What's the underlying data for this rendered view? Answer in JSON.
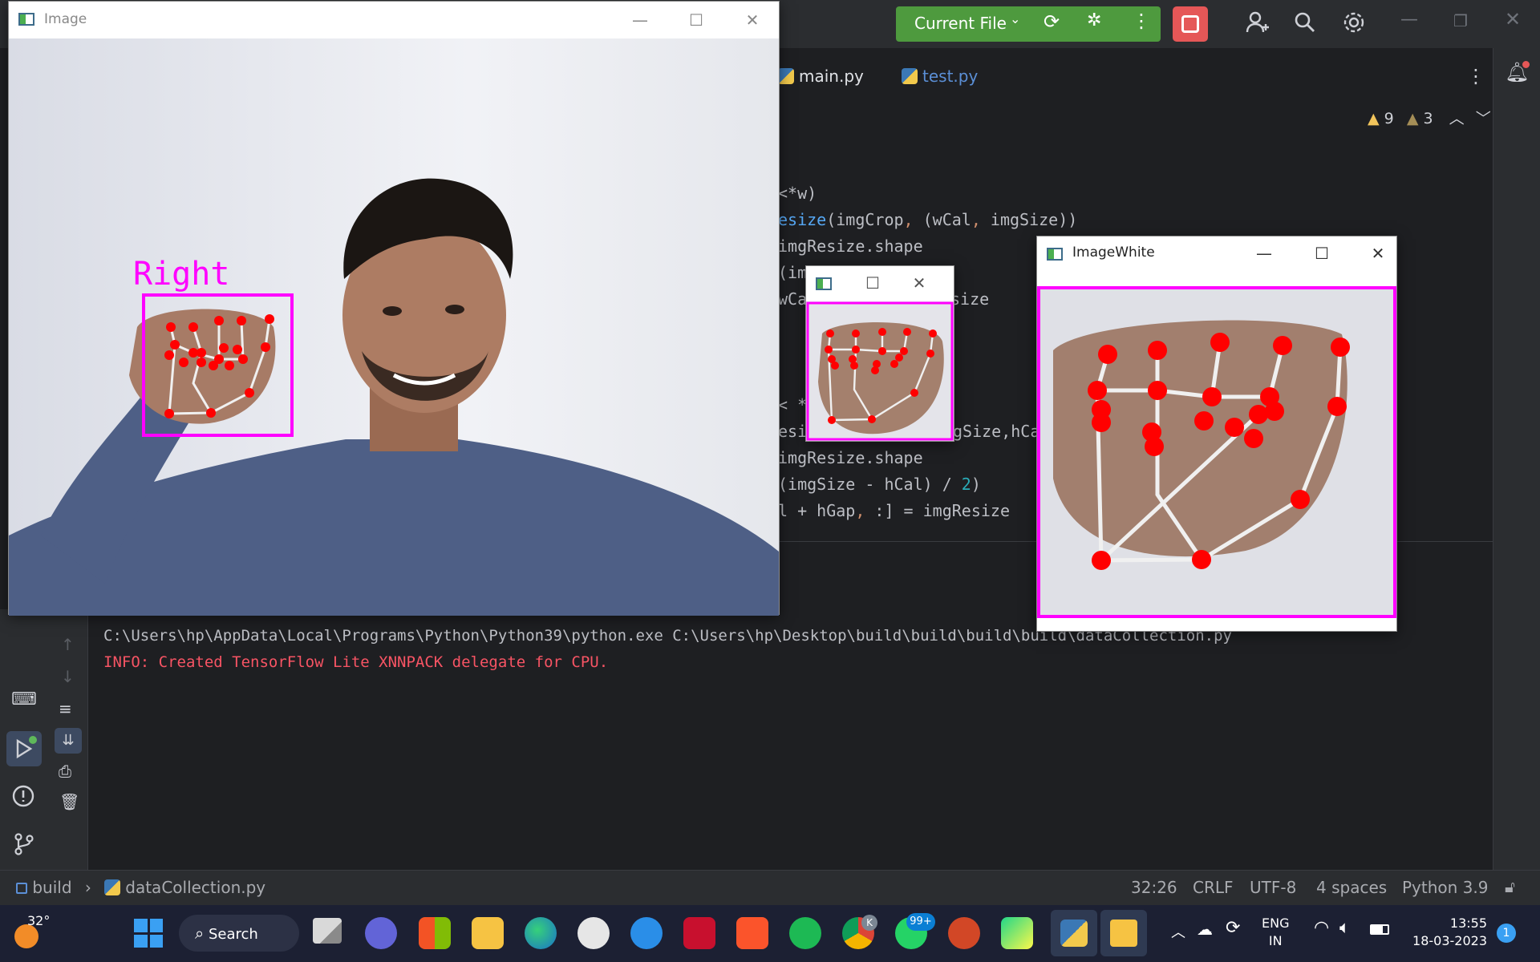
{
  "ide": {
    "run_config": "Current File",
    "tabs": [
      {
        "label": "main.py"
      },
      {
        "label": "test.py"
      }
    ],
    "warnings": "9",
    "weak_warnings": "3",
    "code_lines": [
      "<*w)",
      "esize(imgCrop, (wCal, imgSize))",
      "imgResize.shape",
      "(im",
      "wCa",
      "size",
      "< *",
      "esi",
      "gSize,hCa",
      "imgResize.shape",
      "(imgSize - hCal) / 2)",
      "l + hGap, :] = imgResize"
    ],
    "console_lines": [
      "C:\\Users\\hp\\AppData\\Local\\Programs\\Python\\Python39\\python.exe C:\\Users\\hp\\Desktop\\build\\build\\build\\build\\dataCollection.py",
      "INFO: Created TensorFlow Lite XNNPACK delegate for CPU."
    ],
    "breadcrumb": {
      "project": "build",
      "file": "dataCollection.py"
    },
    "status": {
      "position": "32:26",
      "line_sep": "CRLF",
      "encoding": "UTF-8",
      "indent": "4 spaces",
      "interpreter": "Python 3.9"
    }
  },
  "windows": {
    "image": {
      "title": "Image",
      "label": "Right"
    },
    "crop": {
      "title": ""
    },
    "white": {
      "title": "ImageWhite"
    }
  },
  "taskbar": {
    "weather_temp": "32°",
    "search_label": "Search",
    "whatsapp_badge": "99+",
    "chrome_badge": "K",
    "lang_top": "ENG",
    "lang_bottom": "IN",
    "time": "13:55",
    "date": "18-03-2023",
    "notif_count": "1"
  },
  "colors": {
    "bbox": "#ff00ff",
    "landmark": "#ff0000",
    "run_green": "#4e9a3e",
    "stop_red": "#e55757"
  }
}
